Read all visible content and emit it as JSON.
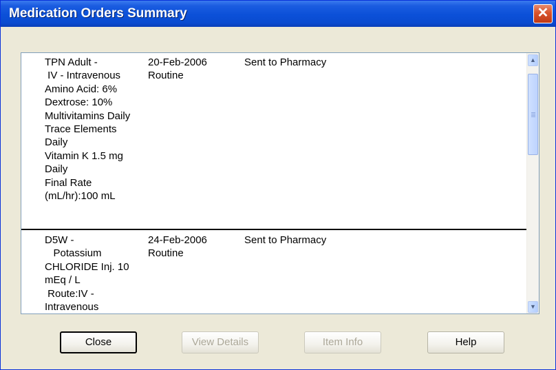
{
  "window": {
    "title": "Medication Orders Summary",
    "close_glyph": "✕"
  },
  "orders": [
    {
      "description": [
        "TPN Adult -",
        " IV - Intravenous",
        "Amino Acid: 6%",
        "Dextrose: 10%",
        "Multivitamins Daily",
        "Trace Elements",
        "Daily",
        "Vitamin K 1.5 mg",
        "Daily",
        "Final Rate",
        "(mL/hr):100 mL"
      ],
      "date": "20-Feb-2006",
      "priority": "Routine",
      "status": "Sent to Pharmacy"
    },
    {
      "description": [
        "D5W -",
        "   Potassium",
        "CHLORIDE Inj. 10",
        "mEq / L",
        " Route:IV -",
        "Intravenous"
      ],
      "date": "24-Feb-2006",
      "priority": "Routine",
      "status": "Sent to Pharmacy"
    }
  ],
  "scrollbar": {
    "up_glyph": "▲",
    "down_glyph": "▼"
  },
  "buttons": {
    "close": "Close",
    "view_details": "View Details",
    "item_info": "Item Info",
    "help": "Help"
  }
}
